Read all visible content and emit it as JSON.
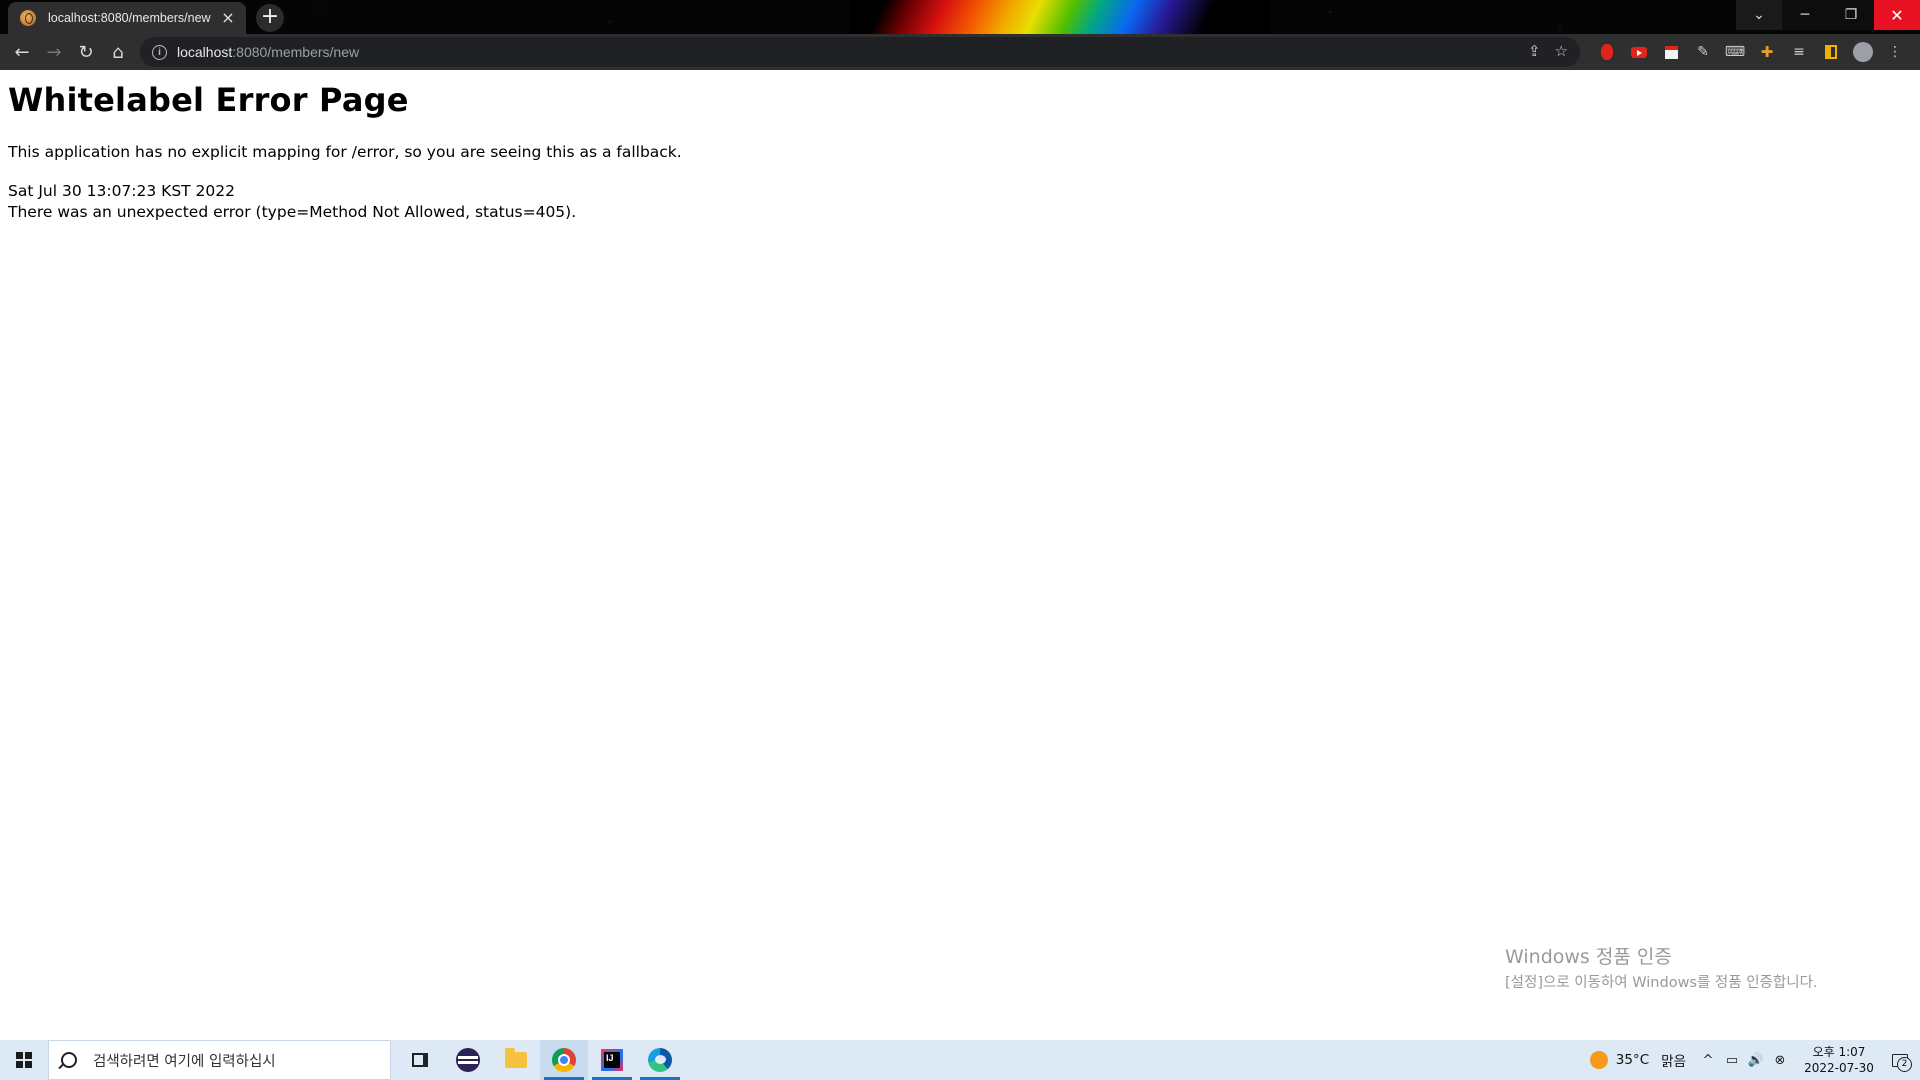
{
  "browser": {
    "tab": {
      "title": "localhost:8080/members/new",
      "close_glyph": "×"
    },
    "new_tab_glyph": "+",
    "window_buttons": {
      "tab_search": "⌄",
      "minimize": "─",
      "restore": "❐",
      "close": "✕"
    },
    "nav": {
      "back": "←",
      "forward": "→",
      "reload": "↻",
      "home": "⌂"
    },
    "address": {
      "host": "localhost",
      "path": ":8080/members/new",
      "info_glyph": "i"
    },
    "omnibox_actions": {
      "share": "⇪",
      "bookmark": "☆"
    },
    "extensions": {
      "pen": "✎",
      "keyboard": "⌨",
      "playlist": "≡",
      "menu": "⋮"
    },
    "accent_colors": {
      "close_button": "#e81123",
      "toolbar": "#2f2f2f",
      "address_bar": "#202124"
    }
  },
  "page": {
    "heading": "Whitelabel Error Page",
    "message": "This application has no explicit mapping for /error, so you are seeing this as a fallback.",
    "timestamp": "Sat Jul 30 13:07:23 KST 2022",
    "error": "There was an unexpected error (type=Method Not Allowed, status=405)."
  },
  "activation": {
    "title": "Windows 정품 인증",
    "subtitle": "[설정]으로 이동하여 Windows를 정품 인증합니다."
  },
  "taskbar": {
    "search_placeholder": "검색하려면 여기에 입력하십시",
    "weather": {
      "temp": "35°C",
      "condition": "맑음"
    },
    "tray": {
      "chevron": "^",
      "volume": "🔊",
      "network": "▭",
      "ime": "⊗"
    },
    "clock": {
      "time": "오후 1:07",
      "date": "2022-07-30"
    },
    "notifications_count": "2",
    "active_indicator_color": "#1a73c8"
  }
}
